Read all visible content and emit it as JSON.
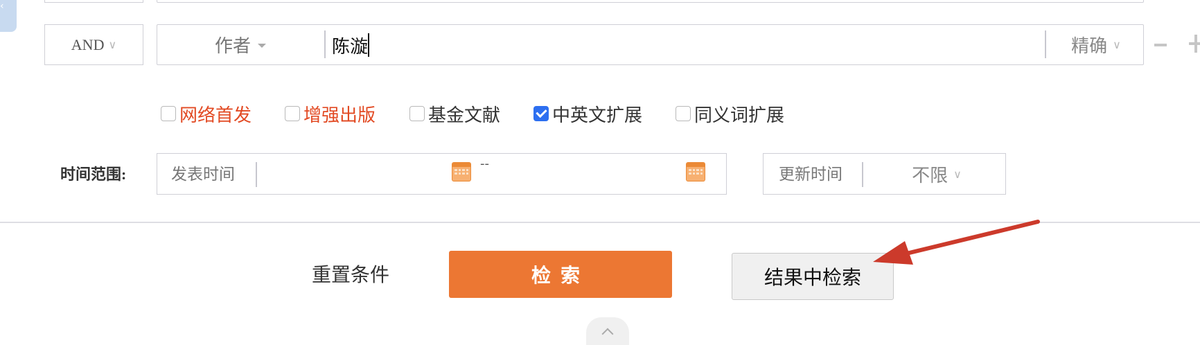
{
  "search_row": {
    "logic_operator": "AND",
    "field": "作者",
    "query_value": "陈漩",
    "match_mode": "精确",
    "minus_label": "−",
    "plus_label": "+"
  },
  "options": [
    {
      "label": "网络首发",
      "checked": false,
      "color": "#e24a23"
    },
    {
      "label": "增强出版",
      "checked": false,
      "color": "#e24a23"
    },
    {
      "label": "基金文献",
      "checked": false,
      "color": "#333333"
    },
    {
      "label": "中英文扩展",
      "checked": true,
      "color": "#333333"
    },
    {
      "label": "同义词扩展",
      "checked": false,
      "color": "#333333"
    }
  ],
  "time_range": {
    "label": "时间范围:",
    "type": "发表时间",
    "separator": "--",
    "update_label": "更新时间",
    "update_value": "不限"
  },
  "actions": {
    "reset": "重置条件",
    "search": "检索",
    "search_within": "结果中检索"
  },
  "colors": {
    "primary": "#ec7733",
    "accent_red": "#e24a23",
    "checkbox_blue": "#2d6ff0",
    "annotation_arrow": "#cc3a2b"
  }
}
